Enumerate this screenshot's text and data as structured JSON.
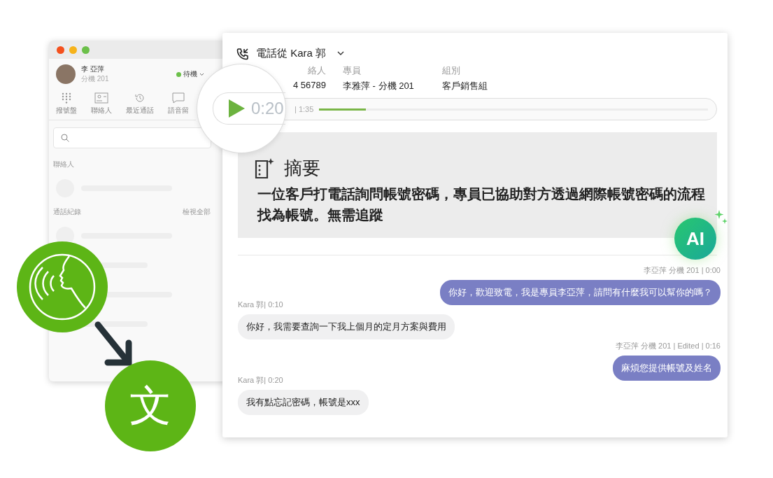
{
  "back_window": {
    "user": {
      "name": "李 亞萍",
      "extension": "分機 201"
    },
    "status": "待機",
    "nav": [
      {
        "label": "撥號盤",
        "kind": "dialpad"
      },
      {
        "label": "聯絡人",
        "kind": "contacts"
      },
      {
        "label": "最近通話",
        "kind": "history"
      },
      {
        "label": "語音留",
        "kind": "voicemail"
      }
    ],
    "sections": [
      {
        "label": "聯絡人"
      },
      {
        "label": "通話紀錄",
        "action": "檢視全部"
      }
    ]
  },
  "call": {
    "title": "電話從 Kara 郭",
    "fields": [
      {
        "label": "絡人",
        "value": "4 56789"
      },
      {
        "label": "專員",
        "value": "李雅萍 - 分機 201"
      },
      {
        "label": "組別",
        "value": "客戶銷售組"
      }
    ],
    "player": {
      "current": "0:20",
      "total": "| 1:35",
      "level": 0.12
    },
    "summary": {
      "title": "摘要",
      "text": "一位客戶打電話詢問帳號密碼，專員已協助對方透過網際帳號密碼的流程找為帳號。無需追蹤"
    },
    "ai_badge": "AI",
    "messages": [
      {
        "kind": "agent",
        "meta": "李亞萍 分機 201 | 0:00",
        "text": "你好，歡迎致電，我是專員李亞萍，請問有什麼我可以幫你的嗎？"
      },
      {
        "kind": "customer",
        "meta": "Kara 郭| 0:10",
        "text": "你好，我需要查詢一下我上個月的定月方案與費用"
      },
      {
        "kind": "agent",
        "meta": "李亞萍 分機 201 | Edited | 0:16",
        "text": "麻煩您提供帳號及姓名"
      },
      {
        "kind": "customer",
        "meta": "Kara 郭| 0:20",
        "text": "我有點忘記密碼，帳號是xxx"
      }
    ]
  },
  "translate_glyph": "文"
}
